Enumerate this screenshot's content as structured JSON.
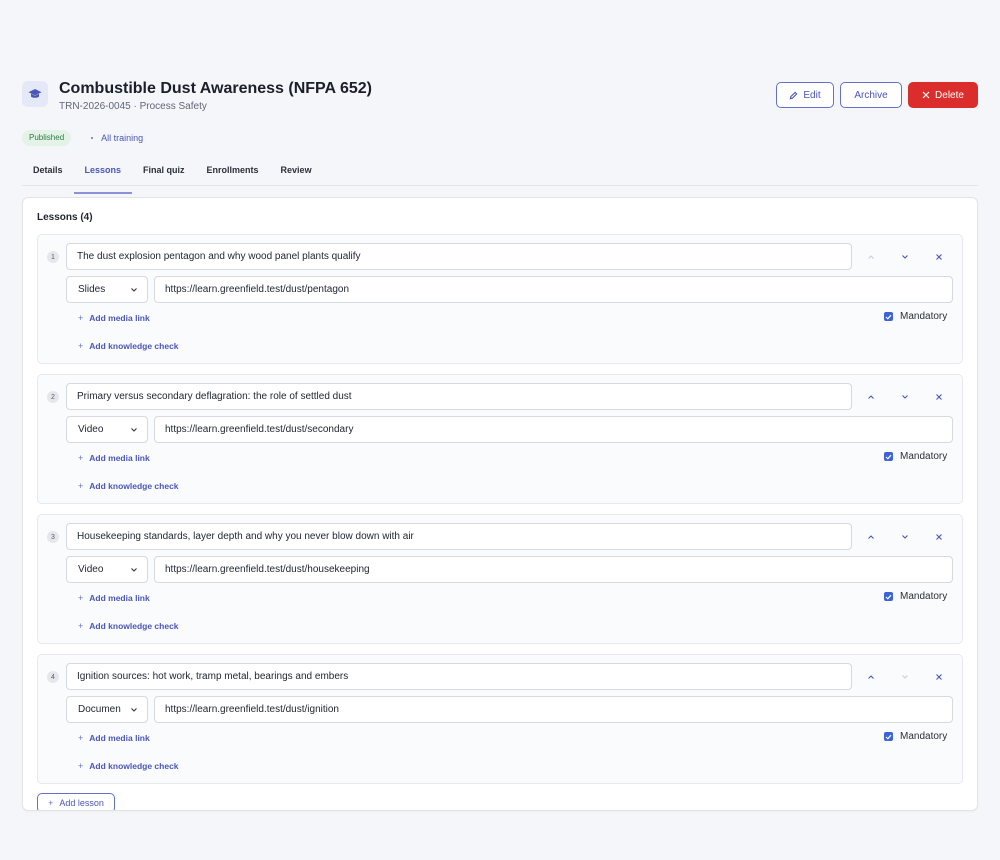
{
  "header": {
    "title": "Combustible Dust Awareness (NFPA 652)",
    "subtitle": "TRN-2026-0045 · Process Safety",
    "icon": "graduation-cap-icon",
    "edit_label": "Edit",
    "archive_label": "Archive",
    "delete_label": "Delete"
  },
  "meta": {
    "status": "Published",
    "back_link": "All training"
  },
  "tabs": [
    {
      "label": "Details",
      "active": false
    },
    {
      "label": "Lessons",
      "active": true
    },
    {
      "label": "Final quiz",
      "active": false
    },
    {
      "label": "Enrollments",
      "active": false
    },
    {
      "label": "Review",
      "active": false
    }
  ],
  "lessons_section": {
    "title": "Lessons (4)",
    "add_media_label": "Add media link",
    "add_check_label": "Add knowledge check",
    "mandatory_label": "Mandatory",
    "add_lesson_label": "Add lesson"
  },
  "lessons": [
    {
      "number": "1",
      "title": "The dust explosion pentagon and why wood panel plants qualify",
      "media_type": "Slides",
      "url": "https://learn.greenfield.test/dust/pentagon",
      "mandatory": true,
      "can_move_up": false,
      "can_move_down": true
    },
    {
      "number": "2",
      "title": "Primary versus secondary deflagration: the role of settled dust",
      "media_type": "Video",
      "url": "https://learn.greenfield.test/dust/secondary",
      "mandatory": true,
      "can_move_up": true,
      "can_move_down": true
    },
    {
      "number": "3",
      "title": "Housekeeping standards, layer depth and why you never blow down with air",
      "media_type": "Video",
      "url": "https://learn.greenfield.test/dust/housekeeping",
      "mandatory": true,
      "can_move_up": true,
      "can_move_down": true
    },
    {
      "number": "4",
      "title": "Ignition sources: hot work, tramp metal, bearings and embers",
      "media_type": "Documen",
      "url": "https://learn.greenfield.test/dust/ignition",
      "mandatory": true,
      "can_move_up": true,
      "can_move_down": false
    }
  ],
  "colors": {
    "accent": "#4a56b8",
    "danger": "#dc2d2d",
    "checkbox": "#3d63d8",
    "success_bg": "#e4f3e7"
  }
}
